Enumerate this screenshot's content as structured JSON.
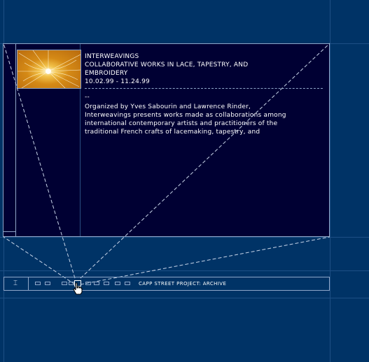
{
  "exhibition": {
    "title": "INTERWEAVINGS",
    "subtitle_line1": "COLLABORATIVE WORKS IN LACE, TAPESTRY, AND",
    "subtitle_line2": "EMBROIDERY",
    "dates": "10.02.99 - 11.24.99",
    "dashes": "--",
    "description_lines": [
      "Organized by Yves Sabourin and Lawrence Rinder,",
      "Interweavings presents works made as collaborations among",
      "international contemporary artists and practitioners of the",
      "traditional French crafts of lacemaking, tapestry, and"
    ],
    "thumbnail_icon": "starburst-image"
  },
  "toolbar": {
    "caption_icon": "I-beam-icon",
    "caption_glyph": "⌶",
    "archive_label": "CAPP STREET PROJECT: ARCHIVE",
    "nav_item_count": 10,
    "active_nav_index": 4
  },
  "colors": {
    "background": "#003366",
    "panel": "#000033",
    "line": "#8fa6c8",
    "text": "#ffffff",
    "thumbnail": "#d58a16"
  }
}
